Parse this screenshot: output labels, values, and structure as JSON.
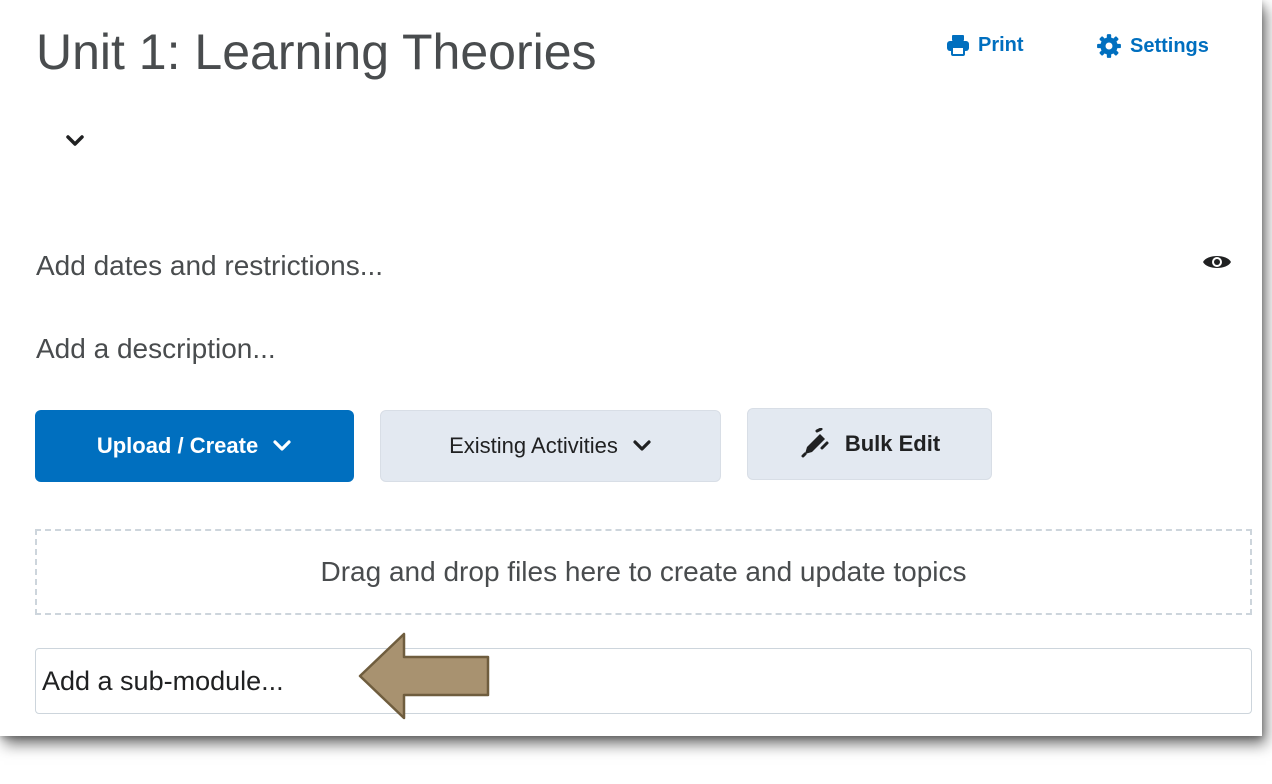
{
  "module": {
    "title": "Unit 1: Learning Theories",
    "dates_prompt": "Add dates and restrictions...",
    "description_prompt": "Add a description..."
  },
  "header_actions": {
    "print_label": "Print",
    "settings_label": "Settings"
  },
  "toolbar": {
    "upload_create_label": "Upload / Create",
    "existing_activities_label": "Existing Activities",
    "bulk_edit_label": "Bulk Edit"
  },
  "dropzone": {
    "text": "Drag and drop files here to create and update topics"
  },
  "submodule": {
    "placeholder": "Add a sub-module..."
  },
  "icons": {
    "print": "printer-icon",
    "settings": "gear-icon",
    "collapse": "chevron-down-icon",
    "visibility": "eye-icon",
    "bulk_edit": "pencil-icon",
    "callout": "left-arrow-icon"
  },
  "colors": {
    "accent": "#006fbf",
    "secondary_button": "#e3e9f1",
    "text": "#494c4e",
    "callout_arrow": "#a89270"
  }
}
